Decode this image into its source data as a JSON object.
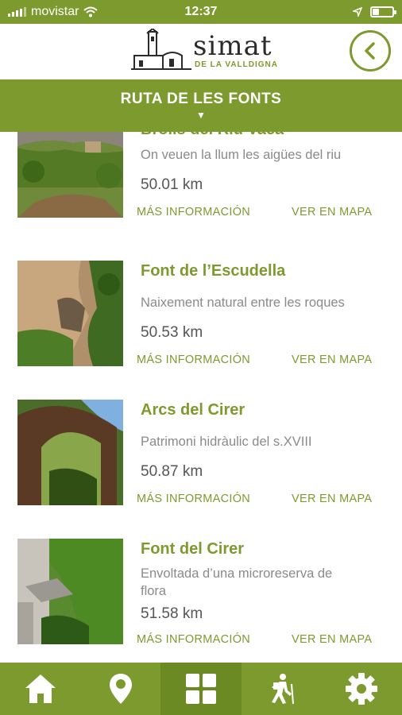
{
  "status": {
    "carrier": "movistar",
    "time": "12:37"
  },
  "header": {
    "logo_title": "simat",
    "logo_subtitle": "DE LA VALLDIGNA"
  },
  "section": {
    "title": "RUTA DE LES FONTS",
    "caret": "▼"
  },
  "items": [
    {
      "title": "Brolls del Riu Vaca",
      "description": "On veuen la llum les aigües del riu",
      "distance": "50.01 km",
      "info_label": "MÁS INFORMACIÓN",
      "map_label": "VER EN MAPA"
    },
    {
      "title": "Font de l’Escudella",
      "description": "Naixement natural entre les roques",
      "distance": "50.53 km",
      "info_label": "MÁS INFORMACIÓN",
      "map_label": "VER EN MAPA"
    },
    {
      "title": "Arcs del Cirer",
      "description": "Patrimoni hidràulic del s.XVIII",
      "distance": "50.87 km",
      "info_label": "MÁS INFORMACIÓN",
      "map_label": "VER EN MAPA"
    },
    {
      "title": "Font del Cirer",
      "description": "Envoltada d’una microreserva de flora",
      "distance": "51.58 km",
      "info_label": "MÁS INFORMACIÓN",
      "map_label": "VER EN MAPA"
    }
  ],
  "tabs": [
    {
      "icon": "home-icon"
    },
    {
      "icon": "map-pin-icon"
    },
    {
      "icon": "grid-icon",
      "active": true
    },
    {
      "icon": "hiker-icon"
    },
    {
      "icon": "gear-icon"
    }
  ],
  "colors": {
    "accent": "#7d9a2e",
    "accent_dark": "#6c8a24"
  }
}
